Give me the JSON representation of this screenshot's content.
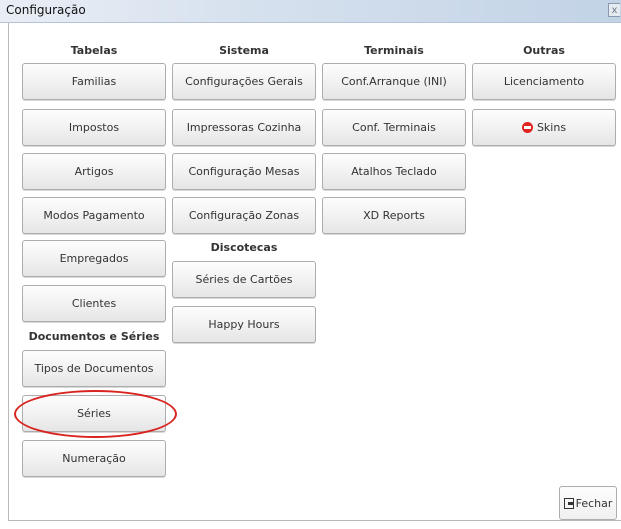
{
  "window": {
    "title": "Configuração",
    "close_glyph": "x"
  },
  "columns": {
    "tabelas": {
      "header": "Tabelas",
      "items": [
        "Familias",
        "Impostos",
        "Artigos",
        "Modos Pagamento",
        "Empregados",
        "Clientes"
      ]
    },
    "documentos": {
      "header": "Documentos e Séries",
      "items": [
        "Tipos de Documentos",
        "Séries",
        "Numeração"
      ]
    },
    "sistema": {
      "header": "Sistema",
      "items": [
        "Configurações Gerais",
        "Impressoras Cozinha",
        "Configuração Mesas",
        "Configuração Zonas"
      ]
    },
    "discotecas": {
      "header": "Discotecas",
      "items": [
        "Séries de Cartões",
        "Happy Hours"
      ]
    },
    "terminais": {
      "header": "Terminais",
      "items": [
        "Conf.Arranque (INI)",
        "Conf. Terminais",
        "Atalhos Teclado",
        "XD Reports"
      ]
    },
    "outras": {
      "header": "Outras",
      "items": [
        "Licenciamento",
        "Skins"
      ]
    }
  },
  "footer": {
    "close_label": "Fechar"
  },
  "icons": {
    "skins": "stop-icon",
    "close": "door-exit-icon"
  },
  "colors": {
    "highlight": "#d9231f",
    "titlebar": "#d6e1ee"
  }
}
